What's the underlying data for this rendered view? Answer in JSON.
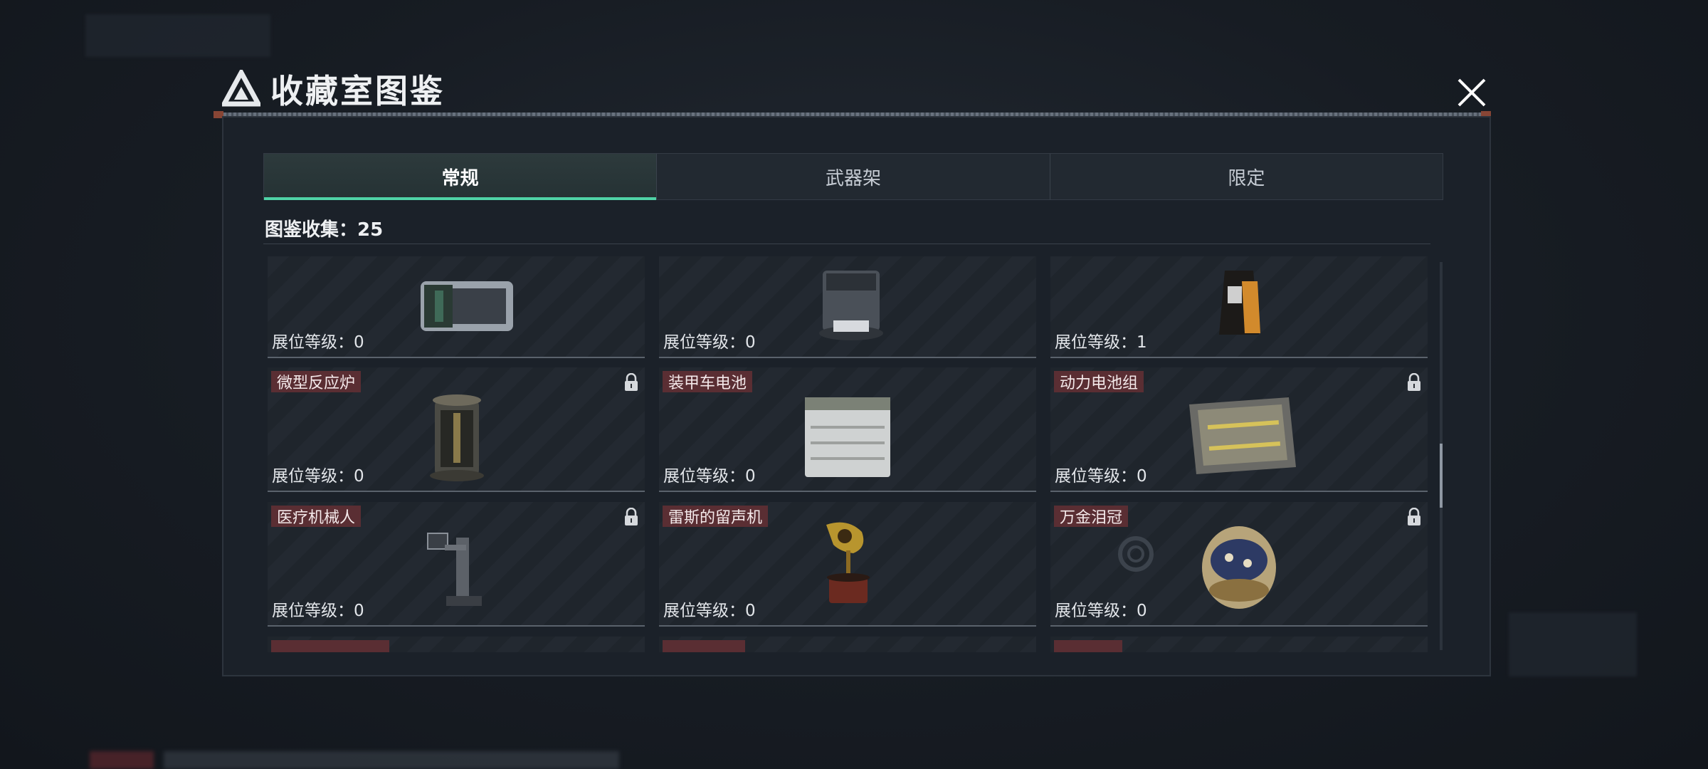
{
  "window": {
    "title": "收藏室图鉴"
  },
  "tabs": [
    {
      "label": "常规",
      "active": true
    },
    {
      "label": "武器架",
      "active": false
    },
    {
      "label": "限定",
      "active": false
    }
  ],
  "collection": {
    "label": "图鉴收集：25"
  },
  "level_prefix": "展位等级：",
  "cards": [
    {
      "name": "",
      "level": "展位等级：0",
      "locked": false,
      "icon": "camera-device-icon"
    },
    {
      "name": "",
      "level": "展位等级：0",
      "locked": false,
      "icon": "robot-vacuum-icon"
    },
    {
      "name": "",
      "level": "展位等级：1",
      "locked": false,
      "icon": "coffee-bag-icon"
    },
    {
      "name": "微型反应炉",
      "level": "展位等级：0",
      "locked": true,
      "icon": "micro-reactor-icon"
    },
    {
      "name": "装甲车电池",
      "level": "展位等级：0",
      "locked": false,
      "icon": "car-battery-icon"
    },
    {
      "name": "动力电池组",
      "level": "展位等级：0",
      "locked": true,
      "icon": "battery-pack-icon"
    },
    {
      "name": "医疗机械人",
      "level": "展位等级：0",
      "locked": true,
      "icon": "medical-robot-icon"
    },
    {
      "name": "雷斯的留声机",
      "level": "展位等级：0",
      "locked": false,
      "icon": "gramophone-icon"
    },
    {
      "name": "万金泪冠",
      "level": "展位等级：0",
      "locked": true,
      "icon": "jeweled-egg-icon"
    }
  ],
  "colors": {
    "accent": "#4fd3a6",
    "badge": "#5a2e33",
    "panel": "#1b2129"
  }
}
